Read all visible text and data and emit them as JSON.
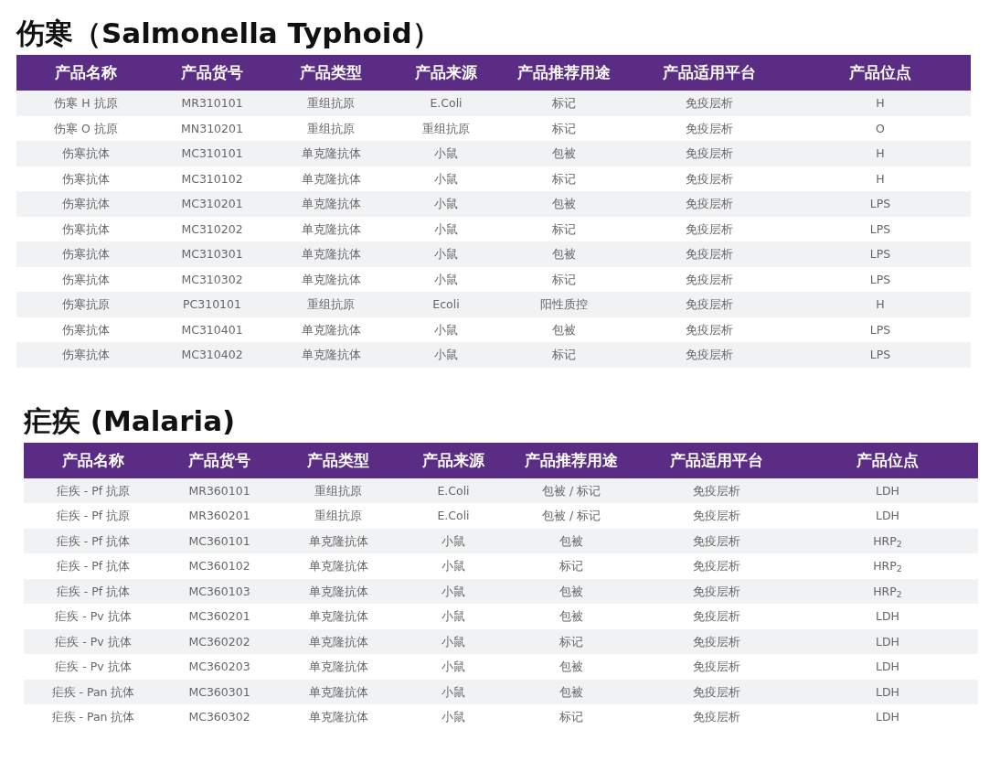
{
  "sections": [
    {
      "title": "伤寒（Salmonella Typhoid）",
      "columns": [
        "产品名称",
        "产品货号",
        "产品类型",
        "产品来源",
        "产品推荐用途",
        "产品适用平台",
        "产品位点"
      ],
      "rows": [
        [
          "伤寒 H 抗原",
          "MR310101",
          "重组抗原",
          "E.Coli",
          "标记",
          "免疫层析",
          "H"
        ],
        [
          "伤寒 O 抗原",
          "MN310201",
          "重组抗原",
          "重组抗原",
          "标记",
          "免疫层析",
          "O"
        ],
        [
          "伤寒抗体",
          "MC310101",
          "单克隆抗体",
          "小鼠",
          "包被",
          "免疫层析",
          "H"
        ],
        [
          "伤寒抗体",
          "MC310102",
          "单克隆抗体",
          "小鼠",
          "标记",
          "免疫层析",
          "H"
        ],
        [
          "伤寒抗体",
          "MC310201",
          "单克隆抗体",
          "小鼠",
          "包被",
          "免疫层析",
          "LPS"
        ],
        [
          "伤寒抗体",
          "MC310202",
          "单克隆抗体",
          "小鼠",
          "标记",
          "免疫层析",
          "LPS"
        ],
        [
          "伤寒抗体",
          "MC310301",
          "单克隆抗体",
          "小鼠",
          "包被",
          "免疫层析",
          "LPS"
        ],
        [
          "伤寒抗体",
          "MC310302",
          "单克隆抗体",
          "小鼠",
          "标记",
          "免疫层析",
          "LPS"
        ],
        [
          "伤寒抗原",
          "PC310101",
          "重组抗原",
          "Ecoli",
          "阳性质控",
          "免疫层析",
          "H"
        ],
        [
          "伤寒抗体",
          "MC310401",
          "单克隆抗体",
          "小鼠",
          "包被",
          "免疫层析",
          "LPS"
        ],
        [
          "伤寒抗体",
          "MC310402",
          "单克隆抗体",
          "小鼠",
          "标记",
          "免疫层析",
          "LPS"
        ]
      ]
    },
    {
      "title": "疟疾 (Malaria)",
      "columns": [
        "产品名称",
        "产品货号",
        "产品类型",
        "产品来源",
        "产品推荐用途",
        "产品适用平台",
        "产品位点"
      ],
      "rows": [
        [
          "疟疾 - Pf 抗原",
          "MR360101",
          "重组抗原",
          "E.Coli",
          "包被 / 标记",
          "免疫层析",
          "LDH"
        ],
        [
          "疟疾 - Pf 抗原",
          "MR360201",
          "重组抗原",
          "E.Coli",
          "包被 / 标记",
          "免疫层析",
          "LDH"
        ],
        [
          "疟疾 - Pf 抗体",
          "MC360101",
          "单克隆抗体",
          "小鼠",
          "包被",
          "免疫层析",
          "HRP$_{2}$"
        ],
        [
          "疟疾 - Pf 抗体",
          "MC360102",
          "单克隆抗体",
          "小鼠",
          "标记",
          "免疫层析",
          "HRP$_{2}$"
        ],
        [
          "疟疾 - Pf 抗体",
          "MC360103",
          "单克隆抗体",
          "小鼠",
          "包被",
          "免疫层析",
          "HRP$_{2}$"
        ],
        [
          "疟疾 - Pv 抗体",
          "MC360201",
          "单克隆抗体",
          "小鼠",
          "包被",
          "免疫层析",
          "LDH"
        ],
        [
          "疟疾 - Pv 抗体",
          "MC360202",
          "单克隆抗体",
          "小鼠",
          "标记",
          "免疫层析",
          "LDH"
        ],
        [
          "疟疾 - Pv 抗体",
          "MC360203",
          "单克隆抗体",
          "小鼠",
          "包被",
          "免疫层析",
          "LDH"
        ],
        [
          "疟疾 - Pan 抗体",
          "MC360301",
          "单克隆抗体",
          "小鼠",
          "包被",
          "免疫层析",
          "LDH"
        ],
        [
          "疟疾 - Pan 抗体",
          "MC360302",
          "单克隆抗体",
          "小鼠",
          "标记",
          "免疫层析",
          "LDH"
        ]
      ]
    }
  ]
}
